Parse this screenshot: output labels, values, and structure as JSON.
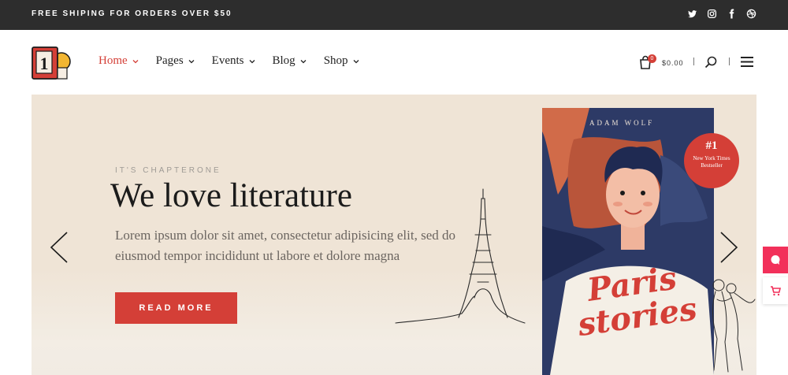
{
  "topbar": {
    "promo": "FREE SHIPING FOR ORDERS OVER $50",
    "socials": [
      "twitter-icon",
      "instagram-icon",
      "facebook-icon",
      "dribbble-icon"
    ]
  },
  "header": {
    "logo_text": "1",
    "nav": [
      {
        "label": "Home",
        "active": true
      },
      {
        "label": "Pages",
        "active": false
      },
      {
        "label": "Events",
        "active": false
      },
      {
        "label": "Blog",
        "active": false
      },
      {
        "label": "Shop",
        "active": false
      }
    ],
    "cart_count": "0",
    "cart_total": "$0.00"
  },
  "hero": {
    "eyebrow": "IT'S CHAPTERONE",
    "headline": "We love literature",
    "lede": "Lorem ipsum dolor sit amet, consectetur adipisicing elit, sed do eiusmod tempor incididunt ut labore et dolore magna",
    "cta": "READ MORE",
    "book": {
      "author": "ADAM WOLF",
      "title": "Paris stories",
      "badge_rank": "#1",
      "badge_text": "New York Times Bestseller"
    }
  },
  "colors": {
    "accent": "#d43f37",
    "topbar": "#2d2d2d",
    "hero_bg": "#efe4d6",
    "side_tab": "#f2305a"
  }
}
